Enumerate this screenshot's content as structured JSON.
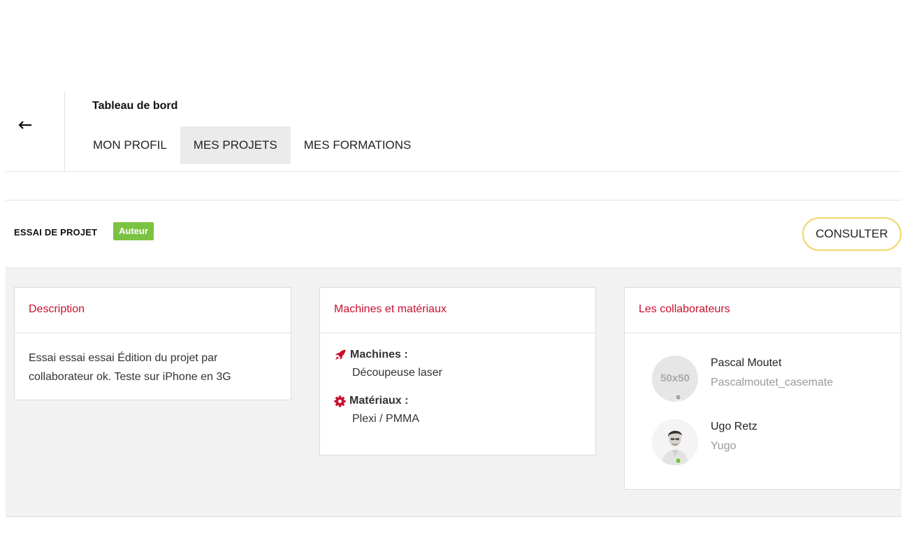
{
  "header": {
    "back_icon": "arrow-left-icon",
    "title": "Tableau de bord",
    "tabs": [
      {
        "label": "MON PROFIL",
        "active": false
      },
      {
        "label": "MES PROJETS",
        "active": true
      },
      {
        "label": "MES FORMATIONS",
        "active": false
      }
    ]
  },
  "project": {
    "name": "ESSAI DE PROJET",
    "role_badge": "Auteur",
    "consult_label": "CONSULTER"
  },
  "description": {
    "title": "Description",
    "text": "Essai essai essai Édition du projet par collaborateur ok. Teste sur iPhone en 3G"
  },
  "machines_materials": {
    "title": "Machines et matériaux",
    "machines": {
      "icon": "rocket-icon",
      "label": "Machines :",
      "value": "Découpeuse laser"
    },
    "materials": {
      "icon": "cog-icon",
      "label": "Matériaux :",
      "value": "Plexi / PMMA"
    }
  },
  "collaborators": {
    "title": "Les collaborateurs",
    "items": [
      {
        "name": "Pascal Moutet",
        "username": "Pascalmoutet_casemate",
        "avatar_text": "50x50",
        "status": "offline"
      },
      {
        "name": "Ugo Retz",
        "username": "Yugo",
        "avatar_text": "",
        "status": "online"
      }
    ]
  },
  "colors": {
    "accent_red": "#c8102e",
    "badge_green": "#7cc242",
    "consult_border": "#f2d56b",
    "status_online": "#7cc242",
    "status_offline": "#aaaaaa"
  }
}
